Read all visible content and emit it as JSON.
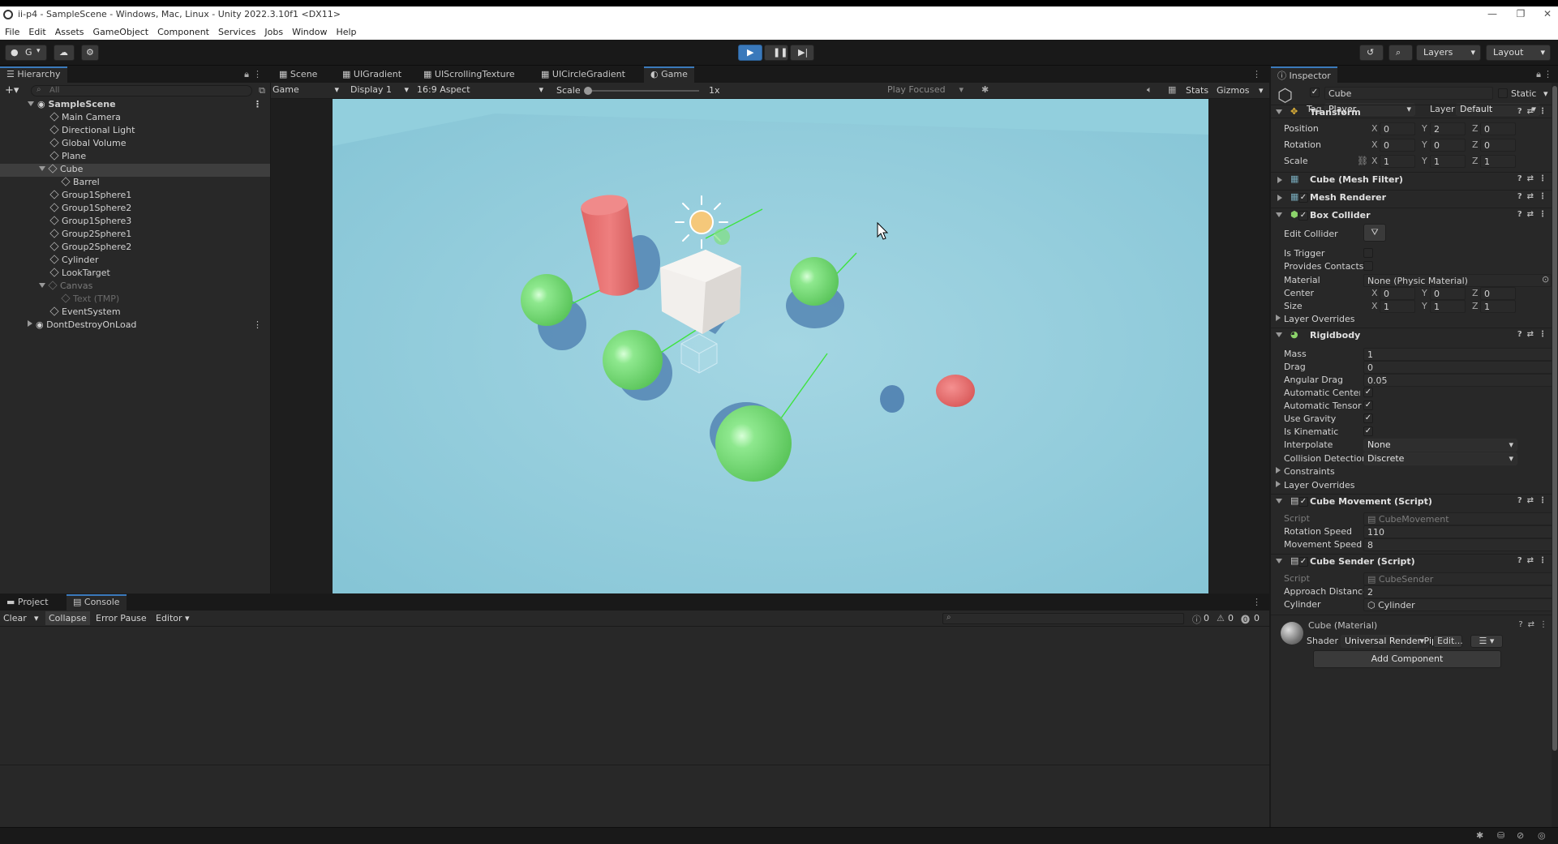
{
  "window": {
    "title": "ii-p4 - SampleScene - Windows, Mac, Linux - Unity 2022.3.10f1 <DX11>"
  },
  "menu": [
    "File",
    "Edit",
    "Assets",
    "GameObject",
    "Component",
    "Services",
    "Jobs",
    "Window",
    "Help"
  ],
  "toolbar": {
    "account": "G",
    "layers": "Layers",
    "layout": "Layout"
  },
  "hierarchy": {
    "tab": "Hierarchy",
    "search_placeholder": "All",
    "items": [
      {
        "label": "SampleScene",
        "depth": 0
      },
      {
        "label": "Main Camera",
        "depth": 1
      },
      {
        "label": "Directional Light",
        "depth": 1
      },
      {
        "label": "Global Volume",
        "depth": 1
      },
      {
        "label": "Plane",
        "depth": 1
      },
      {
        "label": "Cube",
        "depth": 1
      },
      {
        "label": "Barrel",
        "depth": 2
      },
      {
        "label": "Group1Sphere1",
        "depth": 1
      },
      {
        "label": "Group1Sphere2",
        "depth": 1
      },
      {
        "label": "Group1Sphere3",
        "depth": 1
      },
      {
        "label": "Group2Sphere1",
        "depth": 1
      },
      {
        "label": "Group2Sphere2",
        "depth": 1
      },
      {
        "label": "Cylinder",
        "depth": 1
      },
      {
        "label": "LookTarget",
        "depth": 1
      },
      {
        "label": "Canvas",
        "depth": 1
      },
      {
        "label": "Text (TMP)",
        "depth": 2
      },
      {
        "label": "EventSystem",
        "depth": 1
      },
      {
        "label": "DontDestroyOnLoad",
        "depth": 0
      }
    ]
  },
  "center_tabs": [
    "Scene",
    "UIGradient",
    "UIScrollingTexture",
    "UICircleGradient",
    "Game"
  ],
  "game_toolbar": {
    "mode": "Game",
    "display": "Display 1",
    "aspect": "16:9 Aspect",
    "scale_label": "Scale",
    "scale_value": "1x",
    "play_focused": "Play Focused",
    "stats": "Stats",
    "gizmos": "Gizmos"
  },
  "bottom_tabs": [
    "Project",
    "Console"
  ],
  "console": {
    "clear": "Clear",
    "collapse": "Collapse",
    "error_pause": "Error Pause",
    "editor": "Editor",
    "info_count": "0",
    "warn_count": "0",
    "error_count": "0"
  },
  "inspector": {
    "tab": "Inspector",
    "object_name": "Cube",
    "static_label": "Static",
    "tag_label": "Tag",
    "tag_value": "Player",
    "layer_label": "Layer",
    "layer_value": "Default",
    "transform": {
      "title": "Transform",
      "position_label": "Position",
      "position": [
        "0",
        "2",
        "0"
      ],
      "rotation_label": "Rotation",
      "rotation": [
        "0",
        "0",
        "0"
      ],
      "scale_label": "Scale",
      "scale": [
        "1",
        "1",
        "1"
      ]
    },
    "mesh_filter": "Cube (Mesh Filter)",
    "mesh_renderer": "Mesh Renderer",
    "box_collider": {
      "title": "Box Collider",
      "edit_collider": "Edit Collider",
      "is_trigger": "Is Trigger",
      "provides_contacts": "Provides Contacts",
      "material_label": "Material",
      "material_value": "None (Physic Material)",
      "center_label": "Center",
      "center": [
        "0",
        "0",
        "0"
      ],
      "size_label": "Size",
      "size": [
        "1",
        "1",
        "1"
      ],
      "layer_overrides": "Layer Overrides"
    },
    "rigidbody": {
      "title": "Rigidbody",
      "mass_label": "Mass",
      "mass": "1",
      "drag_label": "Drag",
      "drag": "0",
      "angular_drag_label": "Angular Drag",
      "angular_drag": "0.05",
      "auto_com": "Automatic Center Of I",
      "auto_tensor": "Automatic Tensor",
      "use_gravity": "Use Gravity",
      "is_kinematic": "Is Kinematic",
      "interpolate_label": "Interpolate",
      "interpolate": "None",
      "collision_label": "Collision Detection",
      "collision": "Discrete",
      "constraints": "Constraints",
      "layer_overrides": "Layer Overrides"
    },
    "cube_movement": {
      "title": "Cube Movement (Script)",
      "script_label": "Script",
      "script": "CubeMovement",
      "rotation_speed_label": "Rotation Speed",
      "rotation_speed": "110",
      "movement_speed_label": "Movement Speed",
      "movement_speed": "8"
    },
    "cube_sender": {
      "title": "Cube Sender (Script)",
      "script_label": "Script",
      "script": "CubeSender",
      "approach_label": "Approach Distance",
      "approach": "2",
      "cylinder_label": "Cylinder",
      "cylinder": "Cylinder"
    },
    "material": {
      "title": "Cube (Material)",
      "shader_label": "Shader",
      "shader": "Universal Render Pip",
      "edit": "Edit..."
    },
    "add_component": "Add Component"
  },
  "colors": {
    "sky": "#8fcad9",
    "sphere_green": "#7fe07f",
    "cylinder_red": "#e06a6a",
    "accent_blue": "#3a79bb"
  }
}
